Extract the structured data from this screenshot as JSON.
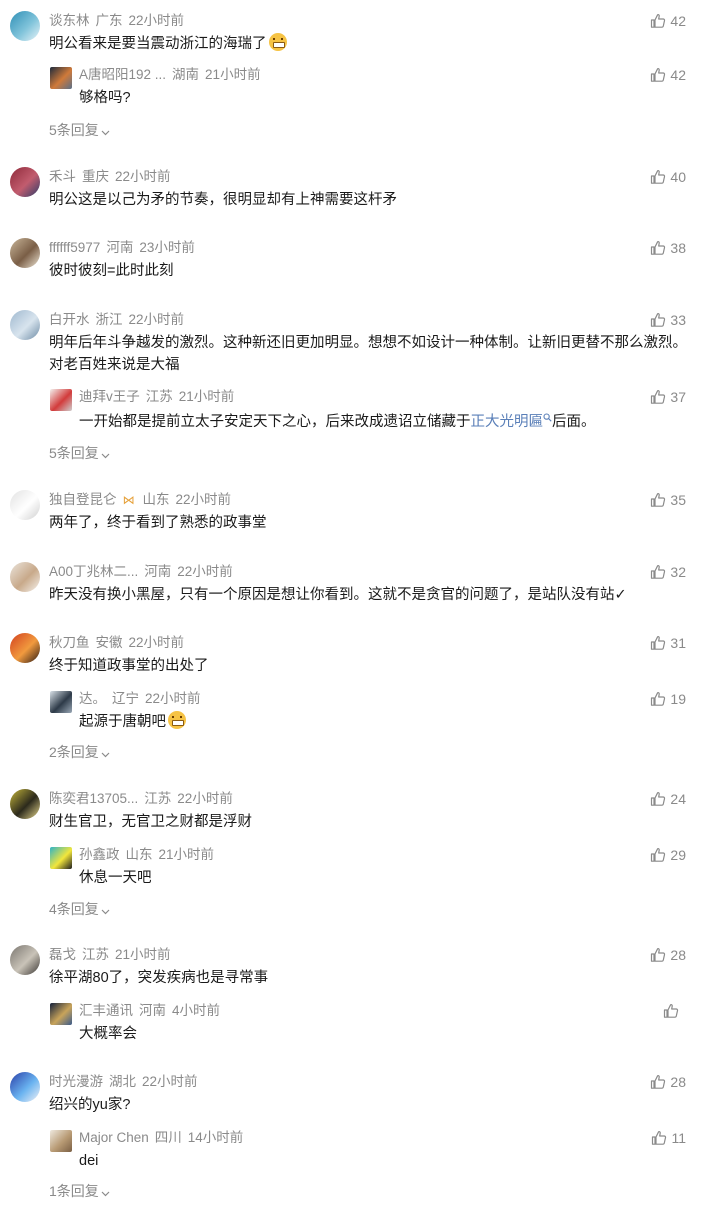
{
  "threads": [
    {
      "author": "谈东林",
      "location": "广东",
      "time": "22小时前",
      "text": "明公看来是要当震动浙江的海瑞了",
      "emoji": "grin",
      "likes": "42",
      "avatar": [
        "#2f8fb6",
        "#7fc3da",
        "#e8f4f8"
      ],
      "replies": [
        {
          "author": "A唐昭阳192 ...",
          "location": "湖南",
          "time": "21小时前",
          "text": "够格吗?",
          "likes": "42",
          "avatar": [
            "#1e2b3c",
            "#d07a3a",
            "#5a6f88"
          ]
        }
      ],
      "more": "5条回复"
    },
    {
      "author": "禾斗",
      "location": "重庆",
      "time": "22小时前",
      "text": "明公这是以己为矛的节奏，很明显却有上神需要这杆矛",
      "likes": "40",
      "avatar": [
        "#8e2a3a",
        "#c25c6e",
        "#2c3c6a"
      ],
      "replies": []
    },
    {
      "author": "ffffff5977",
      "location": "河南",
      "time": "23小时前",
      "text": "彼时彼刻=此时此刻",
      "likes": "38",
      "avatar": [
        "#c9b69a",
        "#7a5e46",
        "#efe6d6"
      ],
      "replies": []
    },
    {
      "author": "白开水",
      "location": "浙江",
      "time": "22小时前",
      "text": "明年后年斗争越发的激烈。这种新还旧更加明显。想想不如设计一种体制。让新旧更替不那么激烈。对老百姓来说是大福",
      "likes": "33",
      "avatar": [
        "#9fb8cf",
        "#d8e4ee",
        "#6d8aa4"
      ],
      "replies": [
        {
          "author": "迪拜v王子",
          "location": "江苏",
          "time": "21小时前",
          "text_pre": "一开始都是提前立太子安定天下之心，后来改成遗诏立储藏于",
          "link": "正大光明匾",
          "text_post": "后面。",
          "likes": "37",
          "avatar": [
            "#f3f1ee",
            "#d23b3b",
            "#cfcfcf"
          ]
        }
      ],
      "more": "5条回复"
    },
    {
      "author": "独自登昆仑",
      "location": "山东",
      "time": "22小时前",
      "text": "两年了，终于看到了熟悉的政事堂",
      "likes": "35",
      "badge": "⋈",
      "avatar": [
        "#e2e2e2",
        "#ffffff",
        "#cfcfcf"
      ],
      "replies": []
    },
    {
      "author": "A00丁兆林二...",
      "location": "河南",
      "time": "22小时前",
      "text": "昨天没有换小黑屋，只有一个原因是想让你看到。这就不是贪官的问题了，是站队没有站✓",
      "likes": "32",
      "avatar": [
        "#eae4dc",
        "#c8a98a",
        "#f7f3ee"
      ],
      "replies": []
    },
    {
      "author": "秋刀鱼",
      "location": "安徽",
      "time": "22小时前",
      "text": "终于知道政事堂的出处了",
      "likes": "31",
      "avatar": [
        "#d2401f",
        "#f19a3e",
        "#2b1a14"
      ],
      "replies": [
        {
          "author": "达。",
          "location": "辽宁",
          "time": "22小时前",
          "text": "起源于唐朝吧",
          "emoji": "grin",
          "likes": "19",
          "avatar": [
            "#d9e1e8",
            "#2d3a48",
            "#9aa8b6"
          ]
        }
      ],
      "more": "2条回复"
    },
    {
      "author": "陈奕君13705...",
      "location": "江苏",
      "time": "22小时前",
      "text": "财生官卫，无官卫之财都是浮财",
      "likes": "24",
      "avatar": [
        "#c4b53a",
        "#2c2a1c",
        "#e8d98e"
      ],
      "replies": [
        {
          "author": "孙鑫政",
          "location": "山东",
          "time": "21小时前",
          "text": "休息一天吧",
          "likes": "29",
          "avatar": [
            "#2fb3c7",
            "#f2e63b",
            "#1d1d1d"
          ]
        }
      ],
      "more": "4条回复"
    },
    {
      "author": "磊戈",
      "location": "江苏",
      "time": "21小时前",
      "text": "徐平湖80了，突发疾病也是寻常事",
      "likes": "28",
      "avatar": [
        "#7a7670",
        "#c9c3b8",
        "#3a3632"
      ],
      "replies": [
        {
          "author": "汇丰通讯",
          "location": "河南",
          "time": "4小时前",
          "text": "大概率会",
          "likes": "",
          "avatar": [
            "#14203a",
            "#c9a45a",
            "#3a5a8a"
          ]
        }
      ]
    },
    {
      "author": "时光漫游",
      "location": "湖北",
      "time": "22小时前",
      "text": "绍兴的yu家?",
      "likes": "28",
      "avatar": [
        "#2a3fa8",
        "#6ab3f0",
        "#f2f2f6"
      ],
      "replies": [
        {
          "author": "Major Chen",
          "location": "四川",
          "time": "14小时前",
          "text": "dei",
          "likes": "11",
          "avatar": [
            "#efe9df",
            "#b89a74",
            "#7a5f44"
          ]
        }
      ],
      "more": "1条回复"
    }
  ]
}
